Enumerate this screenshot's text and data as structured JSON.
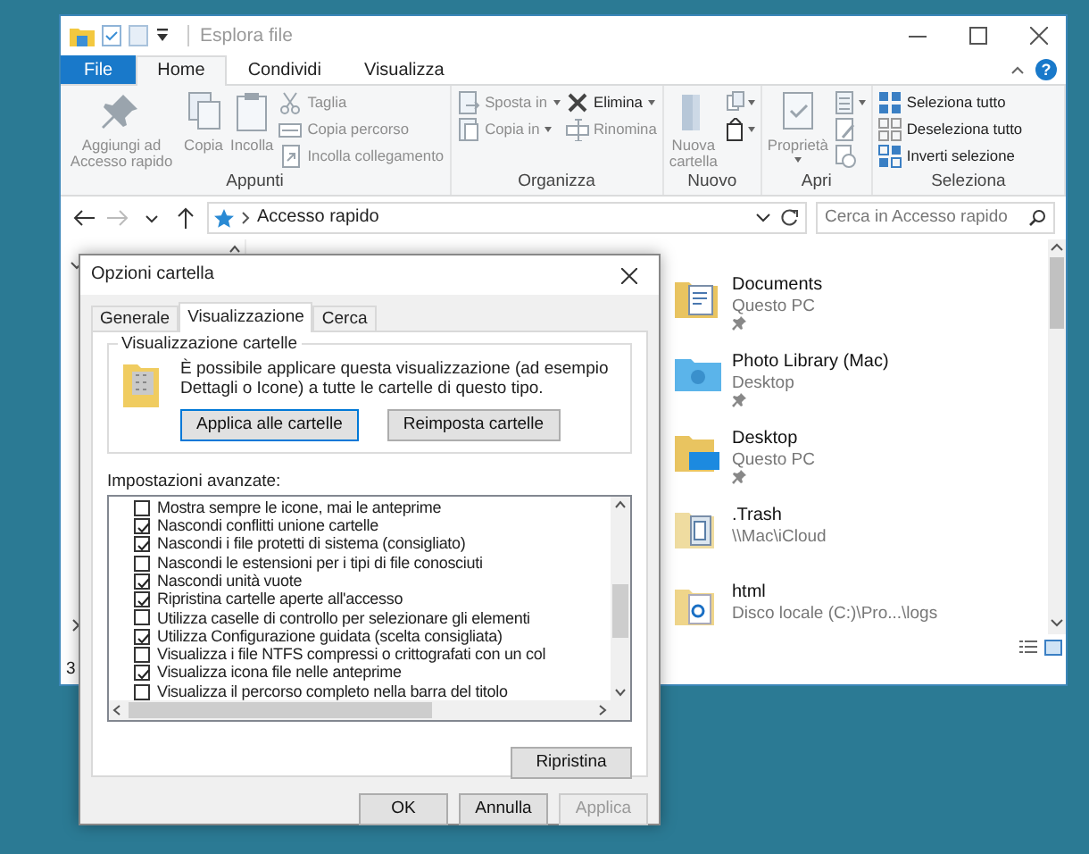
{
  "window": {
    "title": "Esplora file",
    "help": "?"
  },
  "ribbon_tabs": [
    {
      "label": "File",
      "kind": "file",
      "selected": false
    },
    {
      "label": "Home",
      "kind": "tab",
      "selected": true
    },
    {
      "label": "Condividi",
      "kind": "tab",
      "selected": false
    },
    {
      "label": "Visualizza",
      "kind": "tab",
      "selected": false
    }
  ],
  "ribbon_groups": [
    {
      "name": "Appunti",
      "columns": [
        [
          {
            "label": "Aggiungi ad Accesso rapido",
            "kind": "large",
            "disabled": true
          }
        ],
        [
          {
            "label": "Copia",
            "kind": "large",
            "disabled": true
          }
        ],
        [
          {
            "label": "Incolla",
            "kind": "large",
            "disabled": true
          }
        ],
        [
          {
            "label": "Taglia",
            "kind": "small",
            "disabled": true
          },
          {
            "label": "Copia percorso",
            "kind": "small",
            "disabled": true
          },
          {
            "label": "Incolla collegamento",
            "kind": "small",
            "disabled": true
          }
        ]
      ]
    },
    {
      "name": "Organizza",
      "columns": [
        [
          {
            "label": "Sposta in",
            "kind": "small",
            "disabled": true,
            "dropdown": true
          },
          {
            "label": "Copia in",
            "kind": "small",
            "disabled": true,
            "dropdown": true
          }
        ],
        [
          {
            "label": "Elimina",
            "kind": "small",
            "disabled": false,
            "dropdown": true
          },
          {
            "label": "Rinomina",
            "kind": "small",
            "disabled": true
          }
        ]
      ]
    },
    {
      "name": "Nuovo",
      "columns": [
        [
          {
            "label": "Nuova cartella",
            "kind": "large",
            "disabled": true
          }
        ],
        [
          {
            "kind": "icon",
            "disabled": true,
            "dropdown": true
          },
          {
            "kind": "icon",
            "disabled": false,
            "dropdown": true
          }
        ]
      ]
    },
    {
      "name": "Apri",
      "columns": [
        [
          {
            "label": "Proprietà",
            "kind": "large",
            "disabled": true,
            "dropdown": true
          }
        ],
        [
          {
            "kind": "icon",
            "disabled": true,
            "dropdown": true
          },
          {
            "kind": "icon",
            "disabled": true
          },
          {
            "kind": "icon",
            "disabled": true
          }
        ]
      ]
    },
    {
      "name": "Seleziona",
      "columns": [
        [
          {
            "label": "Seleziona tutto",
            "kind": "small",
            "disabled": false
          },
          {
            "label": "Deseleziona tutto",
            "kind": "small",
            "disabled": false
          },
          {
            "label": "Inverti selezione",
            "kind": "small",
            "disabled": false
          }
        ]
      ]
    }
  ],
  "address_bar": {
    "location": "Accesso rapido",
    "search_placeholder": "Cerca in Accesso rapido"
  },
  "items": [
    {
      "name": "Documents",
      "location": "Questo PC",
      "kind": "documents",
      "pinned": true
    },
    {
      "name": "Photo Library (Mac)",
      "location": "Desktop",
      "kind": "photos",
      "pinned": true
    },
    {
      "name": "Desktop",
      "location": "Questo PC",
      "kind": "desktop",
      "pinned": true
    },
    {
      "name": ".Trash",
      "location": "\\\\Mac\\iCloud",
      "kind": "network",
      "pinned": false
    },
    {
      "name": "html",
      "location": "Disco locale (C:)\\Pro...\\logs",
      "kind": "web",
      "pinned": false
    }
  ],
  "status_bar": "3",
  "dialog": {
    "title": "Opzioni cartella",
    "tabs": [
      {
        "label": "Generale",
        "selected": false
      },
      {
        "label": "Visualizzazione",
        "selected": true
      },
      {
        "label": "Cerca",
        "selected": false
      }
    ],
    "group_title": "Visualizzazione cartelle",
    "description": "È possibile applicare questa visualizzazione (ad esempio Dettagli o Icone) a tutte le cartelle di questo tipo.",
    "group_buttons": [
      {
        "label": "Applica alle cartelle",
        "default": true
      },
      {
        "label": "Reimposta cartelle",
        "default": false
      }
    ],
    "advanced_label": "Impostazioni avanzate:",
    "settings": [
      {
        "label": "Mostra sempre le icone, mai le anteprime",
        "checked": false
      },
      {
        "label": "Nascondi conflitti unione cartelle",
        "checked": true
      },
      {
        "label": "Nascondi i file protetti di sistema (consigliato)",
        "checked": true
      },
      {
        "label": "Nascondi le estensioni per i tipi di file conosciuti",
        "checked": false
      },
      {
        "label": "Nascondi unità vuote",
        "checked": true
      },
      {
        "label": "Ripristina cartelle aperte all'accesso",
        "checked": true
      },
      {
        "label": "Utilizza caselle di controllo per selezionare gli elementi",
        "checked": false
      },
      {
        "label": "Utilizza Configurazione guidata (scelta consigliata)",
        "checked": true
      },
      {
        "label": "Visualizza i file NTFS compressi o crittografati con un col",
        "checked": false
      },
      {
        "label": "Visualizza icona file nelle anteprime",
        "checked": true
      },
      {
        "label": "Visualizza il percorso completo nella barra del titolo",
        "checked": false
      }
    ],
    "restore_button": "Ripristina",
    "buttons": [
      {
        "label": "OK",
        "disabled": false
      },
      {
        "label": "Annulla",
        "disabled": false
      },
      {
        "label": "Applica",
        "disabled": true
      }
    ]
  }
}
